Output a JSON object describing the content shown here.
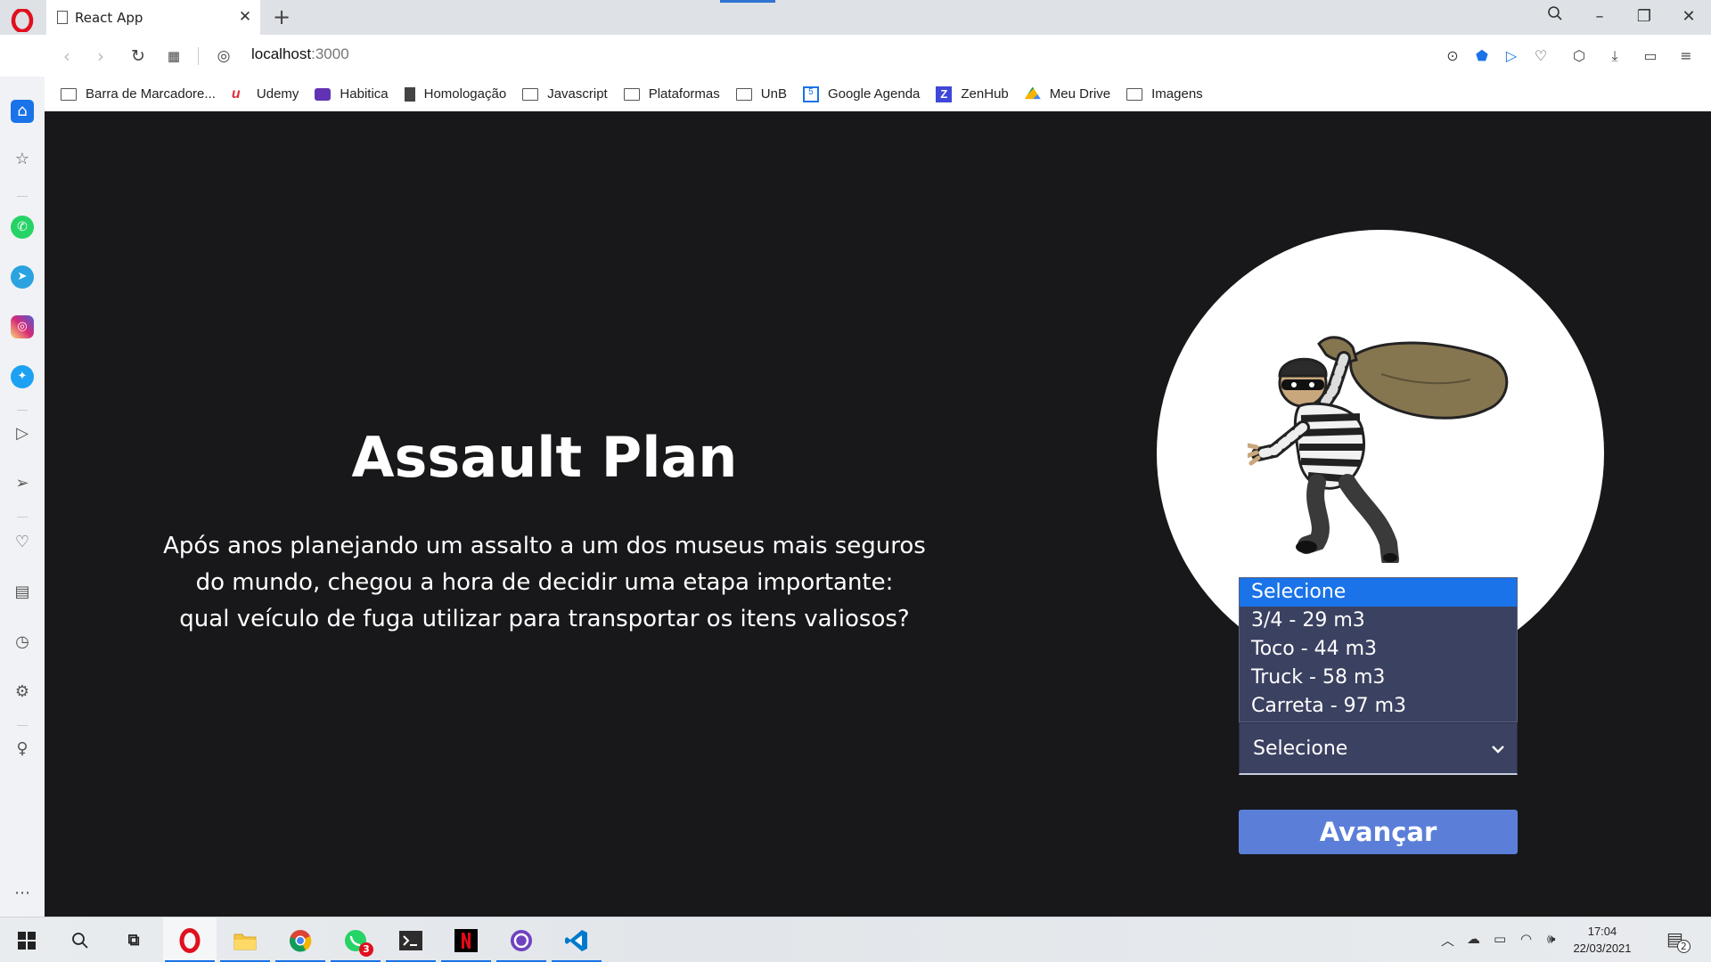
{
  "browser": {
    "tab": {
      "title": "React App"
    },
    "address": {
      "host": "localhost",
      "port": ":3000"
    },
    "bookmarks": [
      {
        "icon": "folder-icon",
        "label": "Barra de Marcadore..."
      },
      {
        "icon": "udemy-icon",
        "label": "Udemy"
      },
      {
        "icon": "habitica-icon",
        "label": "Habitica"
      },
      {
        "icon": "document-icon",
        "label": "Homologação"
      },
      {
        "icon": "folder-icon",
        "label": "Javascript"
      },
      {
        "icon": "folder-icon",
        "label": "Plataformas"
      },
      {
        "icon": "folder-icon",
        "label": "UnB"
      },
      {
        "icon": "google-calendar-icon",
        "label": "Google Agenda"
      },
      {
        "icon": "zenhub-icon",
        "label": "ZenHub"
      },
      {
        "icon": "google-drive-icon",
        "label": "Meu Drive"
      },
      {
        "icon": "folder-icon",
        "label": "Imagens"
      }
    ],
    "gcal_icon_text": "5",
    "zenhub_icon_text": "Z"
  },
  "page": {
    "title": "Assault Plan",
    "description_lines": [
      "Após anos planejando um assalto a um dos museus mais seguros",
      "do mundo, chegou a hora de decidir uma etapa importante:",
      "qual veículo de fuga utilizar para transportar os itens valiosos?"
    ],
    "select": {
      "value": "Selecione",
      "options": [
        "Selecione",
        "3/4 - 29 m3",
        "Toco - 44 m3",
        "Truck - 58 m3",
        "Carreta - 97 m3"
      ]
    },
    "advance_button": "Avançar"
  },
  "taskbar": {
    "whatsapp_badge": "3",
    "time": "17:04",
    "date": "22/03/2021",
    "notifications_count": "2"
  },
  "colors": {
    "page_bg": "#18181a",
    "select_bg": "#3b4160",
    "highlight": "#1a73e8",
    "button_bg": "#5b7fd8"
  }
}
